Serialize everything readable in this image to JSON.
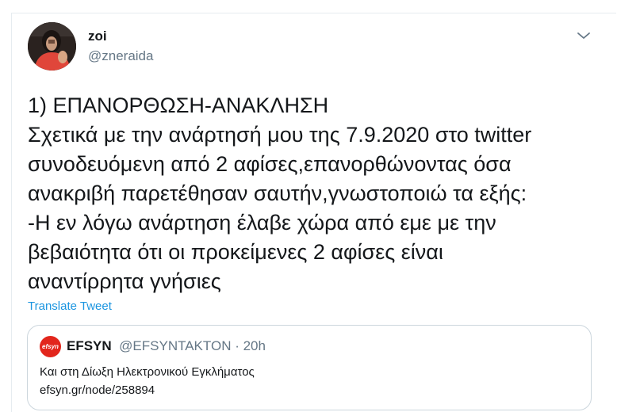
{
  "tweet": {
    "display_name": "zoi",
    "handle": "@zneraida",
    "text": "1) ΕΠΑΝΟΡΘΩΣΗ-ΑΝΑΚΛΗΣΗ\nΣχετικά με την ανάρτησή μου της 7.9.2020 στο twitter\nσυνοδευόμενη από 2 αφίσες,επανορθώνοντας όσα\nανακριβή παρετέθησαν σαυτήν,γνωστοποιώ τα εξής:\n-Η εν λόγω ανάρτηση έλαβε χώρα από εμε με την\nβεβαιότητα ότι οι προκείμενες 2 αφίσες είναι\nαναντίρρητα γνήσιες",
    "translate_label": "Translate Tweet",
    "menu_icon": "chevron-down-icon"
  },
  "quote": {
    "avatar_text": "efsyn",
    "name": "EFSYN",
    "handle": "@EFSYNTAKTON",
    "separator": " · ",
    "time": "20h",
    "text": "Και στη Δίωξη Ηλεκτρονικού Εγκλήματος",
    "link": "efsyn.gr/node/258894"
  },
  "colors": {
    "link_blue": "#1b95e0",
    "secondary_text": "#657786",
    "border": "#ccd6dd",
    "efsyn_red": "#e2261c"
  }
}
